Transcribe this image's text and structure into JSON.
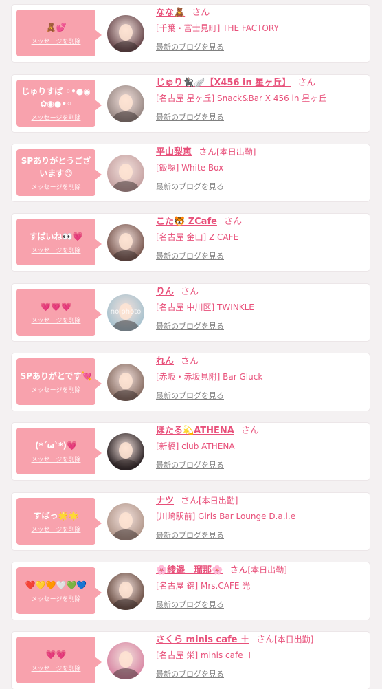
{
  "delete_label": "メッセージを削除",
  "san_label": "さん",
  "blog_label": "最新のブログを見る",
  "colors": {
    "accent": "#e8507a",
    "message_bubble": "#f8a2ad",
    "background": "#f4f1f2",
    "muted_link": "#808080"
  },
  "entries": [
    {
      "message": "🧸💕",
      "name": "なな🧸",
      "status": "",
      "shop": "[千葉・富士見町] THE FACTORY",
      "avatar_color": "#6a4a4e",
      "avatar_text": ""
    },
    {
      "message": "じゅりすば ◦•●◉✿◉●•◦",
      "name": "じゅり🐈‍⬛🪽【X456 in 星ヶ丘】",
      "status": "",
      "shop": "[名古屋 星ヶ丘] Snack&Bar X 456 in 星ヶ丘",
      "avatar_color": "#9a8a86",
      "avatar_text": ""
    },
    {
      "message": "SPありがとうございます😊",
      "name": "平山梨恵",
      "status": "[本日出勤]",
      "shop": "[飯塚] White Box",
      "avatar_color": "#c7a4a4",
      "avatar_text": ""
    },
    {
      "message": "すばいね👀💗",
      "name": "こた🐯 ZCafe",
      "status": "",
      "shop": "[名古屋 金山] Z CAFE",
      "avatar_color": "#7b5a52",
      "avatar_text": ""
    },
    {
      "message": "💗💗💗",
      "name": "りん",
      "status": "",
      "shop": "[名古屋 中川区] TWINKLE",
      "avatar_color": "#a9c3cf",
      "avatar_text": "no photo"
    },
    {
      "message": "SPありがとです💘",
      "name": "れん",
      "status": "",
      "shop": "[赤坂・赤坂見附] Bar Gluck",
      "avatar_color": "#8a7066",
      "avatar_text": ""
    },
    {
      "message": "(*´ω`*)💗",
      "name": "ほたる💫ATHENA",
      "status": "",
      "shop": "[新橋] club ATHENA",
      "avatar_color": "#2f2628",
      "avatar_text": ""
    },
    {
      "message": "すばっ🌟🌟",
      "name": "ナツ",
      "status": "[本日出勤]",
      "shop": "[川崎駅前] Girls Bar Lounge D.a.l.e",
      "avatar_color": "#b49a8e",
      "avatar_text": ""
    },
    {
      "message": "❤️💛🧡🤍💚💙",
      "name": "🌸綾邉　瑠那🌸",
      "status": "[本日出勤]",
      "shop": "[名古屋 錦] Mrs.CAFE 光",
      "avatar_color": "#6e5248",
      "avatar_text": ""
    },
    {
      "message": "💗💗",
      "name": "さくら minis cafe ＋",
      "status": "[本日出勤]",
      "shop": "[名古屋 栄] minis cafe ＋",
      "avatar_color": "#d98aa6",
      "avatar_text": ""
    }
  ]
}
